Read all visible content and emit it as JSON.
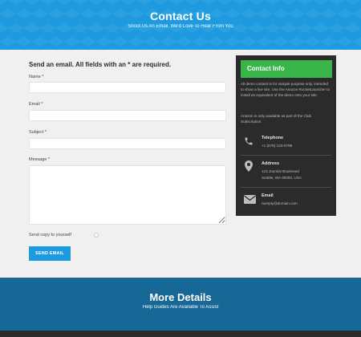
{
  "header": {
    "title": "Contact Us",
    "subtitle": "Shoot Us An Email. We'd Love To Hear From You"
  },
  "form": {
    "heading": "Send an email. All fields with an * are required.",
    "name_label": "Name *",
    "email_label": "Email *",
    "subject_label": "Subject *",
    "message_label": "Message *",
    "copy_label": "Send copy to yourself",
    "send_button": "SEND EMAIL"
  },
  "contact_info": {
    "title": "Contact Info",
    "paragraph1": "All demo content is for sample purpose only, intended to show a live site. Use the Anazon RocketLauncher to install an equivalent of the demo onto your site.",
    "paragraph2": "Anazon is only available as part of the Club Subscription.",
    "telephone_title": "Telephone",
    "telephone_value": "+1 (678)-123-6789",
    "address_title": "Address",
    "address_line1": "123 Joomla! Boulevard",
    "address_line2": "Seattle, WA 00000, USA",
    "email_title": "Email",
    "email_value": "noreply@domain.com",
    "accent": "#3ab54a"
  },
  "details": {
    "title": "More Details",
    "subtitle": "Help Guides Are Available To Assist"
  },
  "colors": {
    "primary": "#1e9be0",
    "details_bg": "#176897",
    "panel_bg": "#2b2b2b"
  }
}
